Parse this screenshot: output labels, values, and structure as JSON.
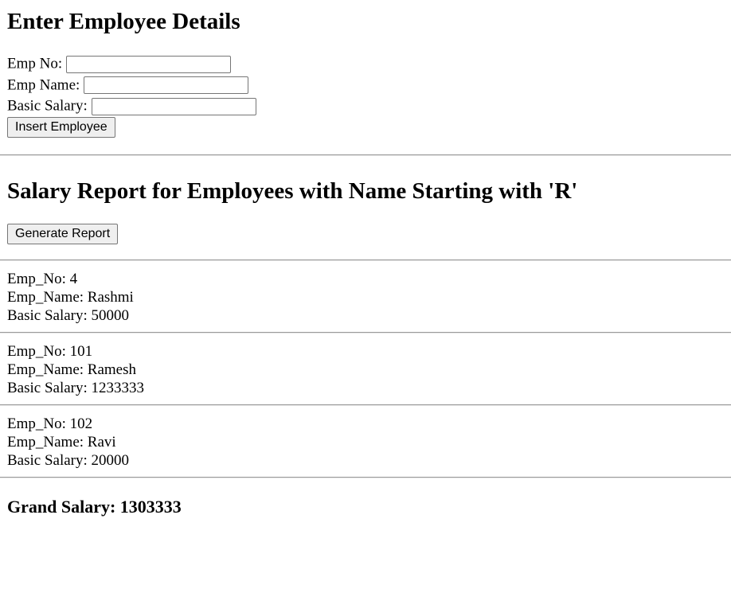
{
  "form": {
    "title": "Enter Employee Details",
    "emp_no_label": "Emp No:",
    "emp_no_value": "",
    "emp_name_label": "Emp Name:",
    "emp_name_value": "",
    "basic_salary_label": "Basic Salary:",
    "basic_salary_value": "",
    "insert_button": "Insert Employee"
  },
  "report": {
    "title": "Salary Report for Employees with Name Starting with 'R'",
    "generate_button": "Generate Report",
    "records": [
      {
        "emp_no": "Emp_No: 4",
        "emp_name": "Emp_Name: Rashmi",
        "salary": "Basic Salary: 50000"
      },
      {
        "emp_no": "Emp_No: 101",
        "emp_name": "Emp_Name: Ramesh",
        "salary": "Basic Salary: 1233333"
      },
      {
        "emp_no": "Emp_No: 102",
        "emp_name": "Emp_Name: Ravi",
        "salary": "Basic Salary: 20000"
      }
    ],
    "grand_total": "Grand Salary: 1303333"
  }
}
